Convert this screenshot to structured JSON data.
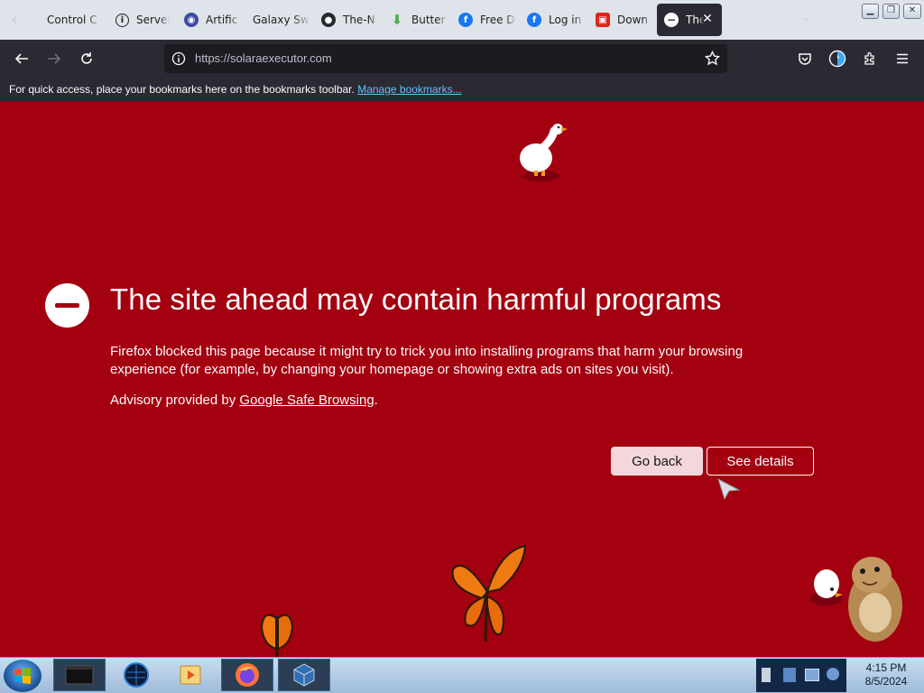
{
  "tabs": [
    {
      "label": "Control C",
      "icon": "control-icon"
    },
    {
      "label": "Server",
      "icon": "info-icon"
    },
    {
      "label": "Artific",
      "icon": "ai-icon"
    },
    {
      "label": "Galaxy Sw",
      "icon": "blank-icon"
    },
    {
      "label": "The-N",
      "icon": "github-icon"
    },
    {
      "label": "Butter",
      "icon": "download-arrow-icon"
    },
    {
      "label": "Free D",
      "icon": "facebook-icon"
    },
    {
      "label": "Log in",
      "icon": "facebook-icon"
    },
    {
      "label": "Down",
      "icon": "roblox-icon"
    },
    {
      "label": "The",
      "icon": "blocked-icon",
      "active": true
    }
  ],
  "url": "https://solaraexecutor.com",
  "bookmarks_bar": {
    "message": "For quick access, place your bookmarks here on the bookmarks toolbar.",
    "link": "Manage bookmarks..."
  },
  "warning": {
    "title": "The site ahead may contain harmful programs",
    "description": "Firefox blocked this page because it might try to trick you into installing programs that harm your browsing experience (for example, by changing your homepage or showing extra ads on sites you visit).",
    "advisory_prefix": "Advisory provided by ",
    "advisory_link": "Google Safe Browsing",
    "advisory_suffix": ".",
    "go_back": "Go back",
    "see_details": "See details"
  },
  "colors": {
    "background": "#a30010",
    "toolbar": "#2b2a33",
    "go_back_bg": "#f3d7da"
  },
  "taskbar": {
    "items": [
      "start-orb",
      "terminal-app",
      "globe-app",
      "media-player",
      "firefox",
      "virtualbox"
    ],
    "time": "4:15 PM",
    "date": "8/5/2024"
  }
}
